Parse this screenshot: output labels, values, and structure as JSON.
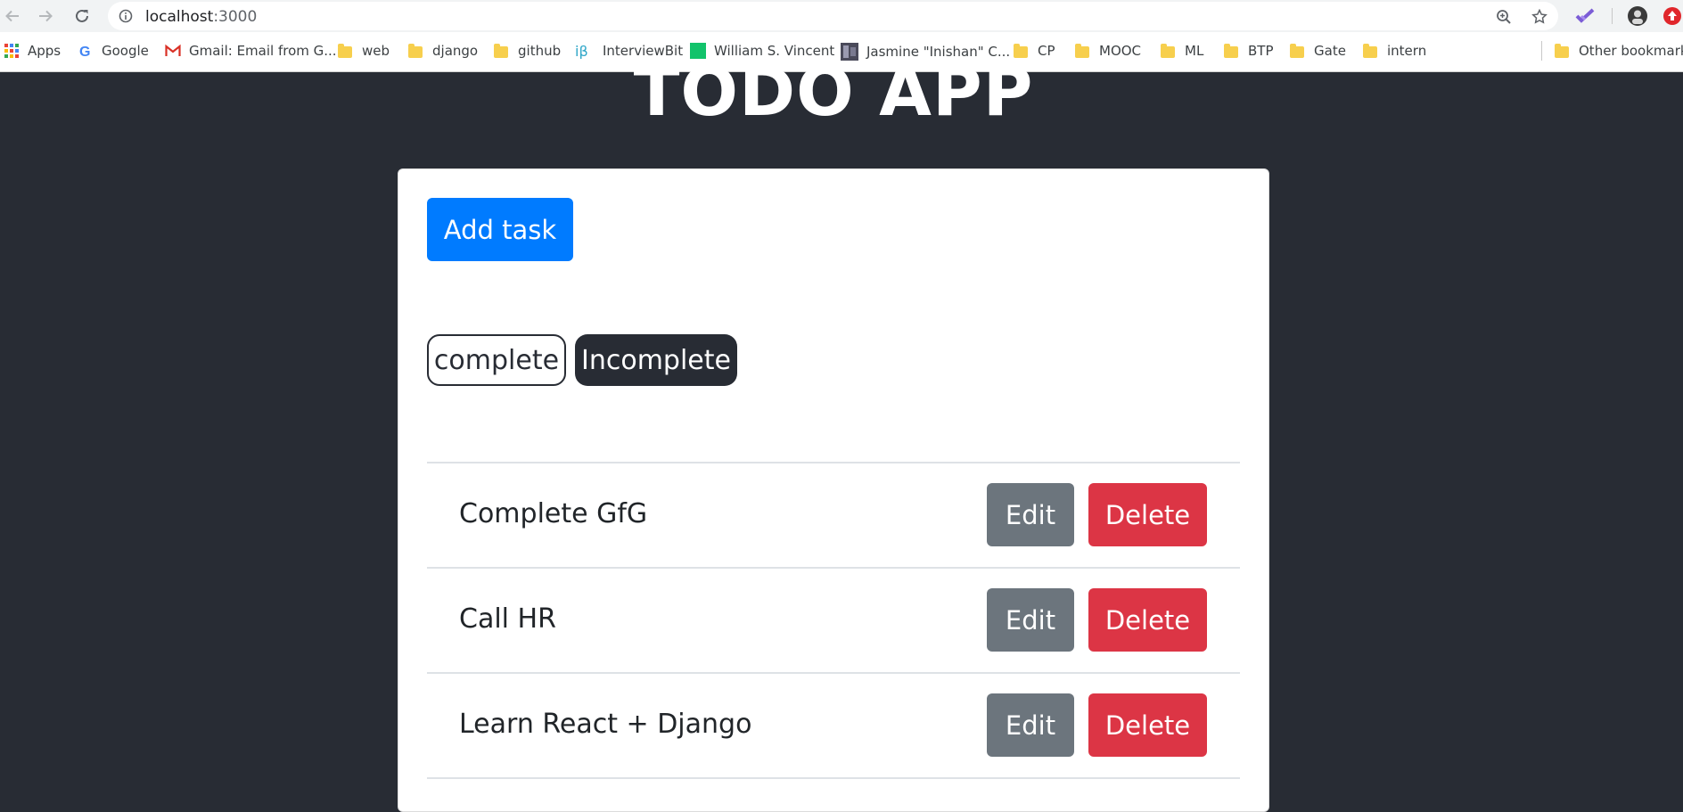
{
  "browser": {
    "url_host": "localhost",
    "url_port": ":3000",
    "bookmarks": [
      {
        "label": "Apps",
        "icon": "apps-grid-icon"
      },
      {
        "label": "Google",
        "icon": "google-icon"
      },
      {
        "label": "Gmail: Email from G...",
        "icon": "gmail-icon"
      },
      {
        "label": "web",
        "icon": "folder-icon"
      },
      {
        "label": "django",
        "icon": "folder-icon"
      },
      {
        "label": "github",
        "icon": "folder-icon"
      },
      {
        "label": "InterviewBit",
        "icon": "interviewbit-icon"
      },
      {
        "label": "William S. Vincent",
        "icon": "green-square-icon"
      },
      {
        "label": "Jasmine \"Inishan\" C...",
        "icon": "thumbnail-icon"
      },
      {
        "label": "CP",
        "icon": "folder-icon"
      },
      {
        "label": "MOOC",
        "icon": "folder-icon"
      },
      {
        "label": "ML",
        "icon": "folder-icon"
      },
      {
        "label": "BTP",
        "icon": "folder-icon"
      },
      {
        "label": "Gate",
        "icon": "folder-icon"
      },
      {
        "label": "intern",
        "icon": "folder-icon"
      }
    ],
    "other_bookmarks": "Other bookmarks"
  },
  "app": {
    "title": "TODO APP",
    "add_task_label": "Add task",
    "tabs": {
      "complete": "complete",
      "incomplete": "Incomplete",
      "active": "incomplete"
    },
    "tasks": [
      {
        "title": "Complete GfG",
        "edit_label": "Edit",
        "delete_label": "Delete"
      },
      {
        "title": "Call HR",
        "edit_label": "Edit",
        "delete_label": "Delete"
      },
      {
        "title": "Learn React + Django",
        "edit_label": "Edit",
        "delete_label": "Delete"
      }
    ]
  },
  "colors": {
    "page_bg": "#282c34",
    "primary": "#007bff",
    "secondary": "#6c757d",
    "danger": "#dc3545"
  }
}
